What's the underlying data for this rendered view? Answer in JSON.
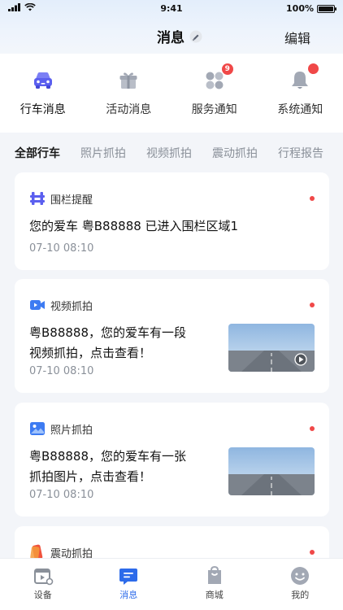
{
  "status_bar": {
    "time": "9:41",
    "battery": "100%"
  },
  "nav": {
    "title": "消息",
    "edit_label": "编辑"
  },
  "categories": [
    {
      "label": "行车消息",
      "icon": "car-icon",
      "active": true
    },
    {
      "label": "活动消息",
      "icon": "gift-icon"
    },
    {
      "label": "服务通知",
      "icon": "apps-icon",
      "badge": "9"
    },
    {
      "label": "系统通知",
      "icon": "bell-icon",
      "dot": true
    }
  ],
  "filters": [
    {
      "label": "全部行车",
      "active": true
    },
    {
      "label": "照片抓拍"
    },
    {
      "label": "视频抓拍"
    },
    {
      "label": "震动抓拍"
    },
    {
      "label": "行程报告"
    }
  ],
  "cards": [
    {
      "type": "围栏提醒",
      "icon": "fence-icon",
      "message": "您的爱车 粤B88888 已进入围栏区域1",
      "time": "07-10 08:10"
    },
    {
      "type": "视频抓拍",
      "icon": "video-icon",
      "message_line1": "粤B88888，您的爱车有一段",
      "message_line2": "视频抓拍，点击查看！",
      "time": "07-10 08:10"
    },
    {
      "type": "照片抓拍",
      "icon": "photo-icon",
      "message_line1": "粤B88888，您的爱车有一张",
      "message_line2": "抓拍图片，点击查看！",
      "time": "07-10 08:10"
    },
    {
      "type": "震动抓拍",
      "icon": "vibration-icon"
    }
  ],
  "tabbar": [
    {
      "label": "设备",
      "icon": "device-icon"
    },
    {
      "label": "消息",
      "icon": "message-icon",
      "active": true
    },
    {
      "label": "商城",
      "icon": "shop-icon"
    },
    {
      "label": "我的",
      "icon": "profile-icon"
    }
  ],
  "colors": {
    "accent": "#2d6bea",
    "badge": "#f04848",
    "car": "#5b5fef"
  }
}
